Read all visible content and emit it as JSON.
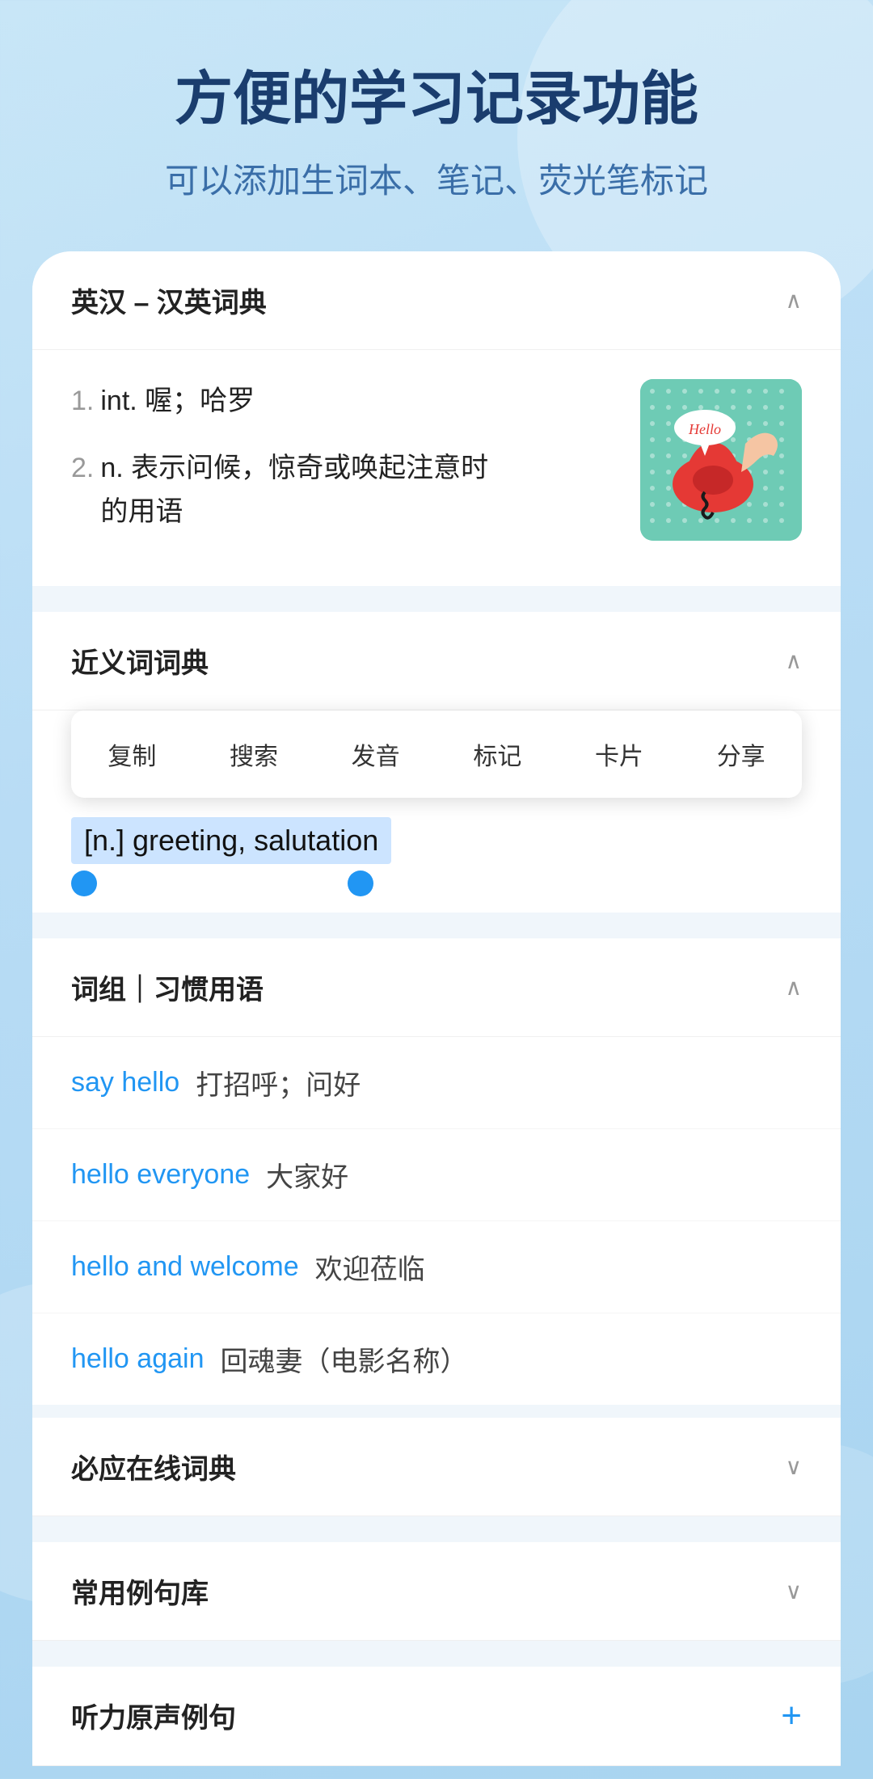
{
  "header": {
    "title": "方便的学习记录功能",
    "subtitle": "可以添加生词本、笔记、荧光笔标记"
  },
  "dict_section": {
    "label": "英汉 – 汉英词典",
    "definitions": [
      {
        "num": "1.",
        "pos": "int.",
        "meaning": "喔；哈罗"
      },
      {
        "num": "2.",
        "pos": "n.",
        "meaning": "表示问候，惊奇或唤起注意时的用语"
      }
    ]
  },
  "synonyms_section": {
    "label": "近义词词典",
    "context_menu": {
      "items": [
        "复制",
        "搜索",
        "发音",
        "标记",
        "卡片",
        "分享"
      ]
    },
    "selected_text": "[n.] greeting, salutation"
  },
  "phrases_section": {
    "label": "词组｜习惯用语",
    "phrases": [
      {
        "en": "say hello",
        "zh": "打招呼；问好"
      },
      {
        "en": "hello everyone",
        "zh": "大家好"
      },
      {
        "en": "hello and welcome",
        "zh": "欢迎莅临"
      },
      {
        "en": "hello again",
        "zh": "回魂妻（电影名称）"
      }
    ]
  },
  "extra_sections": [
    {
      "label": "必应在线词典",
      "type": "chevron-down"
    },
    {
      "label": "常用例句库",
      "type": "chevron-down"
    },
    {
      "label": "听力原声例句",
      "type": "plus"
    }
  ],
  "chevron_up": "∧",
  "chevron_down": "∨",
  "plus": "+"
}
